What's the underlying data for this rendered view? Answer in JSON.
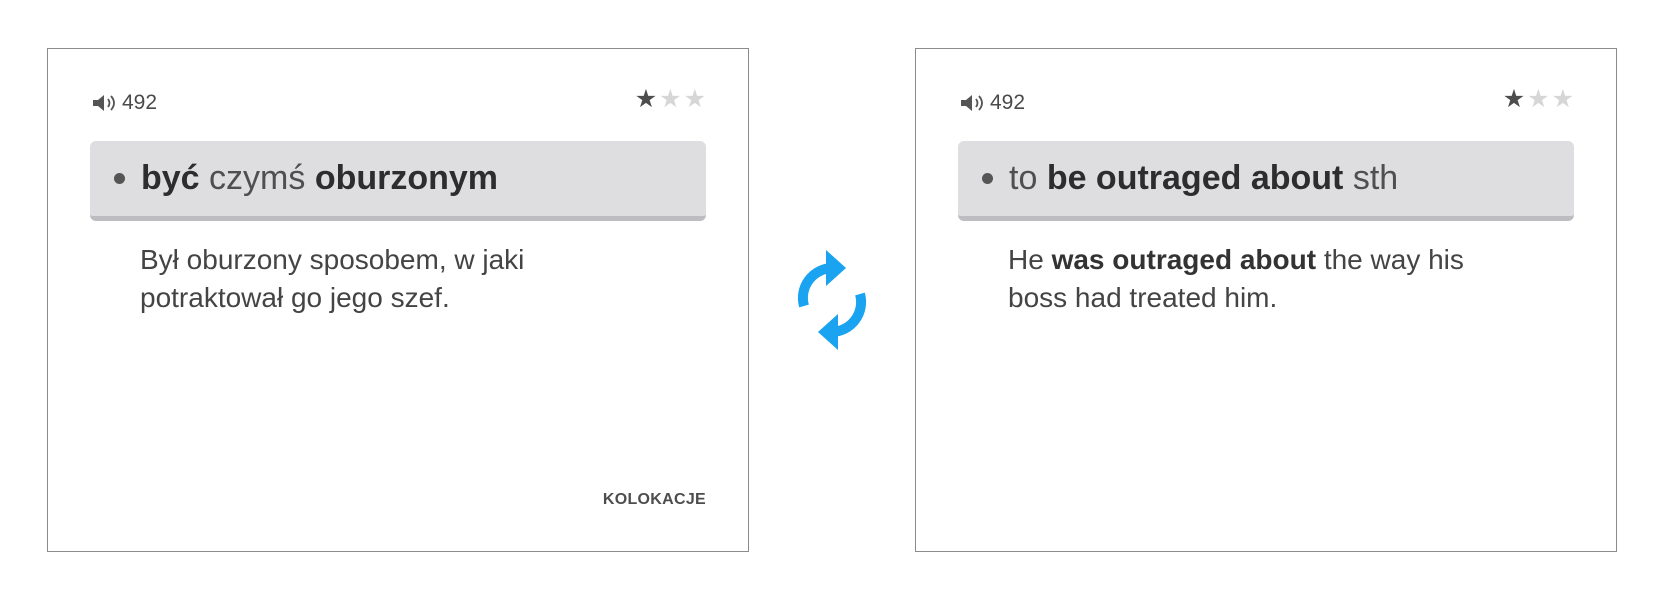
{
  "front": {
    "sound_count": "492",
    "stars": [
      "filled",
      "empty",
      "empty"
    ],
    "phrase": {
      "word1": "być",
      "word2": "czymś",
      "word3": "oburzonym"
    },
    "example": "Był oburzony sposobem, w jaki potraktował go jego szef.",
    "tag": "KOLOKACJE"
  },
  "back": {
    "sound_count": "492",
    "stars": [
      "filled",
      "empty",
      "empty"
    ],
    "phrase": {
      "word1": "to",
      "word2": "be outraged about",
      "word3": "sth"
    },
    "example": {
      "part1": "He",
      "bold": "was outraged about",
      "part2": "the way his boss had treated him."
    }
  },
  "flip_icon": "refresh-icon",
  "colors": {
    "accent": "#1aa3f0",
    "phrase_bar": "#dedee0",
    "border": "#8c8c8c"
  }
}
